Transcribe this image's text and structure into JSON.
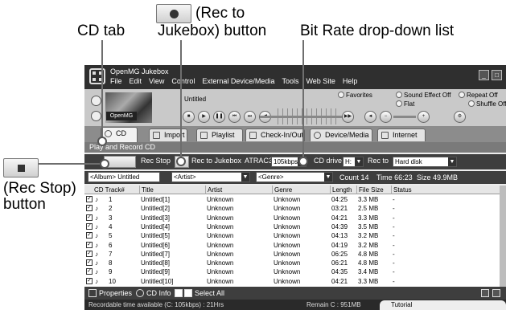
{
  "annotations": {
    "cd_tab": "CD tab",
    "rec_to_jukebox_line1": "(Rec to",
    "rec_to_jukebox_line2": "Jukebox) button",
    "bit_rate": "Bit Rate drop-down list",
    "rec_stop_line1": "(Rec Stop)",
    "rec_stop_line2": "button"
  },
  "app": {
    "title": "OpenMG Jukebox",
    "menu": [
      "File",
      "Edit",
      "View",
      "Control",
      "External Device/Media",
      "Tools",
      "Web Site",
      "Help"
    ],
    "window_buttons": [
      "_",
      "□"
    ]
  },
  "player": {
    "track_title": "Untitled",
    "logo_text": "OpenMG",
    "controls": [
      "■",
      "▶",
      "❚❚",
      "⏮",
      "⏭",
      "◀"
    ],
    "favorites": "Favorites",
    "sound_effect": "Sound Effect Off",
    "sound_effect_value": "Flat",
    "repeat": "Repeat Off",
    "shuffle": "Shuffle Off"
  },
  "tabs": [
    {
      "label": "CD"
    },
    {
      "label": "Import"
    },
    {
      "label": "Playlist"
    },
    {
      "label": "Check-In/Out"
    },
    {
      "label": "Device/Media"
    },
    {
      "label": "Internet"
    }
  ],
  "panel": {
    "header": "Play and Record CD",
    "rec_stop_label": "Rec Stop",
    "rec_to_jukebox_label": "Rec to Jukebox",
    "atrac_label": "ATRAC3",
    "bitrate_value": "105kbps",
    "cd_drive_label": "CD drive",
    "cd_drive_value": "H:",
    "rec_to_label": "Rec to",
    "rec_to_value": "Hard disk",
    "album_value": "<Album> Untitled",
    "artist_value": "<Artist>",
    "genre_value": "<Genre>",
    "count": "Count 14",
    "time": "Time 66:23",
    "size": "Size 49.9MB"
  },
  "table": {
    "headers": [
      "CD Track#",
      "Title",
      "Artist",
      "Genre",
      "Length",
      "File Size",
      "Status"
    ],
    "rows": [
      {
        "n": "1",
        "title": "Untitled[1]",
        "artist": "Unknown",
        "genre": "Unknown",
        "length": "04:25",
        "size": "3.3 MB",
        "status": "-"
      },
      {
        "n": "2",
        "title": "Untitled[2]",
        "artist": "Unknown",
        "genre": "Unknown",
        "length": "03:21",
        "size": "2.5 MB",
        "status": "-"
      },
      {
        "n": "3",
        "title": "Untitled[3]",
        "artist": "Unknown",
        "genre": "Unknown",
        "length": "04:21",
        "size": "3.3 MB",
        "status": "-"
      },
      {
        "n": "4",
        "title": "Untitled[4]",
        "artist": "Unknown",
        "genre": "Unknown",
        "length": "04:39",
        "size": "3.5 MB",
        "status": "-"
      },
      {
        "n": "5",
        "title": "Untitled[5]",
        "artist": "Unknown",
        "genre": "Unknown",
        "length": "04:13",
        "size": "3.2 MB",
        "status": "-"
      },
      {
        "n": "6",
        "title": "Untitled[6]",
        "artist": "Unknown",
        "genre": "Unknown",
        "length": "04:19",
        "size": "3.2 MB",
        "status": "-"
      },
      {
        "n": "7",
        "title": "Untitled[7]",
        "artist": "Unknown",
        "genre": "Unknown",
        "length": "06:25",
        "size": "4.8 MB",
        "status": "-"
      },
      {
        "n": "8",
        "title": "Untitled[8]",
        "artist": "Unknown",
        "genre": "Unknown",
        "length": "06:21",
        "size": "4.8 MB",
        "status": "-"
      },
      {
        "n": "9",
        "title": "Untitled[9]",
        "artist": "Unknown",
        "genre": "Unknown",
        "length": "04:35",
        "size": "3.4 MB",
        "status": "-"
      },
      {
        "n": "10",
        "title": "Untitled[10]",
        "artist": "Unknown",
        "genre": "Unknown",
        "length": "04:21",
        "size": "3.3 MB",
        "status": "-"
      }
    ]
  },
  "bottom": {
    "properties": "Properties",
    "cd_info": "CD Info",
    "select_all": "Select All"
  },
  "status": {
    "recordable": "Recordable time available (C: 105kbps) : 21Hrs",
    "remain": "Remain C : 951MB",
    "tutorial": "Tutorial"
  }
}
